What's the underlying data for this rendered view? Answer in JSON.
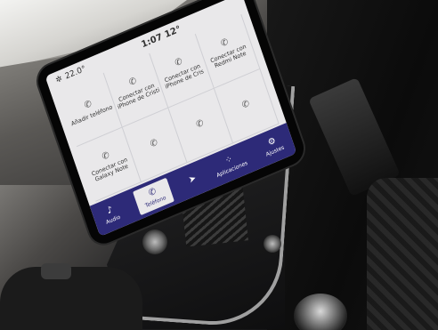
{
  "status": {
    "temperature": "22.0°",
    "time": "1:07",
    "outside_temp": "12°"
  },
  "tiles": [
    {
      "icon": "phone-icon",
      "glyph": "✆",
      "label": "Añadir teléfono"
    },
    {
      "icon": "phone-icon",
      "glyph": "✆",
      "label": "Conectar con iPhone de Cristi"
    },
    {
      "icon": "phone-icon",
      "glyph": "✆",
      "label": "Conectar con iPhone de Cris"
    },
    {
      "icon": "phone-icon",
      "glyph": "✆",
      "label": "Conectar con Redmi Note"
    },
    {
      "icon": "phone-icon",
      "glyph": "✆",
      "label": "Conectar con Galaxy Note"
    },
    {
      "icon": "phone-icon",
      "glyph": "✆",
      "label": ""
    },
    {
      "icon": "phone-icon",
      "glyph": "✆",
      "label": ""
    },
    {
      "icon": "phone-icon",
      "glyph": "✆",
      "label": ""
    }
  ],
  "nav": [
    {
      "icon": "music-icon",
      "glyph": "♪",
      "label": "Audio"
    },
    {
      "icon": "phone-icon",
      "glyph": "✆",
      "label": "Teléfono"
    },
    {
      "icon": "navigation-icon",
      "glyph": "➤",
      "label": ""
    },
    {
      "icon": "apps-icon",
      "glyph": "⁘",
      "label": "Aplicaciones"
    },
    {
      "icon": "settings-icon",
      "glyph": "⚙",
      "label": "Ajustes"
    }
  ],
  "colors": {
    "nav_background": "#2d2a78",
    "screen_background": "#e9e8ea"
  }
}
